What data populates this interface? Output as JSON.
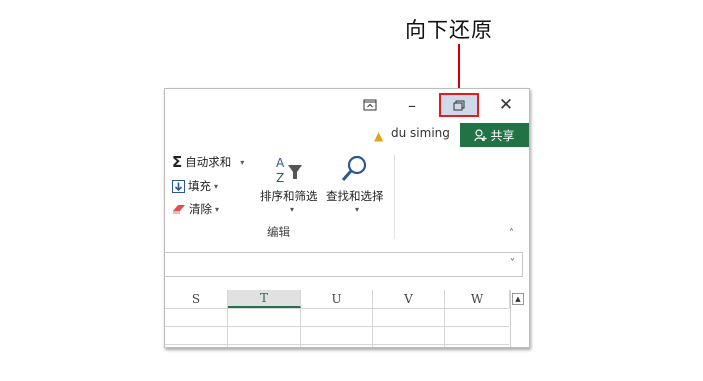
{
  "callout": {
    "text": "向下还原",
    "line_color": "#d40000"
  },
  "window_controls": {
    "ribbon_options_glyph": "⊼",
    "minimize_glyph": "–",
    "restore_glyph": "🗗",
    "close_glyph": "✕"
  },
  "account": {
    "warning_glyph": "▲",
    "username": "du siming",
    "share_label": "共享",
    "share_icon": "person-add-icon"
  },
  "ribbon": {
    "autosum_label": "自动求和",
    "fill_label": "填充",
    "clear_label": "清除",
    "sort_filter_label": "排序和筛选",
    "find_select_label": "查找和选择",
    "group_label": "编辑",
    "collapse_glyph": "˄",
    "dropdown_glyph": "▾"
  },
  "formula_bar": {
    "expand_glyph": "˅"
  },
  "sheet": {
    "columns": [
      "S",
      "T",
      "U",
      "V",
      "W"
    ],
    "selected_column": "T",
    "accent_color": "#217346"
  }
}
